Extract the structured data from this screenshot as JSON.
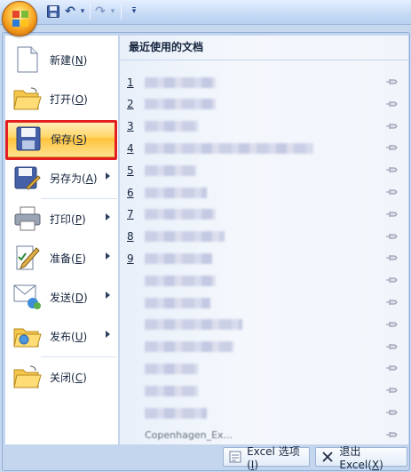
{
  "qat": {
    "undo_glyph": "↶",
    "redo_glyph": "↷",
    "dropdown_glyph": "▾"
  },
  "menu": {
    "items": [
      {
        "label": "新建(",
        "key": "N",
        "tail": ")",
        "icon": "new-document-icon"
      },
      {
        "label": "打开(",
        "key": "O",
        "tail": ")",
        "icon": "open-folder-icon"
      },
      {
        "label": "保存(",
        "key": "S",
        "tail": ")",
        "icon": "save-icon"
      },
      {
        "label": "另存为(",
        "key": "A",
        "tail": ")",
        "icon": "save-as-icon"
      },
      {
        "label": "打印(",
        "key": "P",
        "tail": ")",
        "icon": "print-icon"
      },
      {
        "label": "准备(",
        "key": "E",
        "tail": ")",
        "icon": "prepare-icon"
      },
      {
        "label": "发送(",
        "key": "D",
        "tail": ")",
        "icon": "send-icon"
      },
      {
        "label": "发布(",
        "key": "U",
        "tail": ")",
        "icon": "publish-icon"
      },
      {
        "label": "关闭(",
        "key": "C",
        "tail": ")",
        "icon": "close-document-icon"
      }
    ]
  },
  "recent": {
    "title": "最近使用的文档",
    "numbers": [
      "1",
      "2",
      "3",
      "4",
      "5",
      "6",
      "7",
      "8",
      "9"
    ],
    "last_item": "Copenhagen_Ex..."
  },
  "bottom": {
    "options_label": "Excel 选项(",
    "options_key": "I",
    "options_tail": ")",
    "exit_label": "退出 Excel(",
    "exit_key": "X",
    "exit_tail": ")"
  },
  "colors": {
    "highlight": "#e31f1f",
    "active_item": "#ffc33c"
  }
}
